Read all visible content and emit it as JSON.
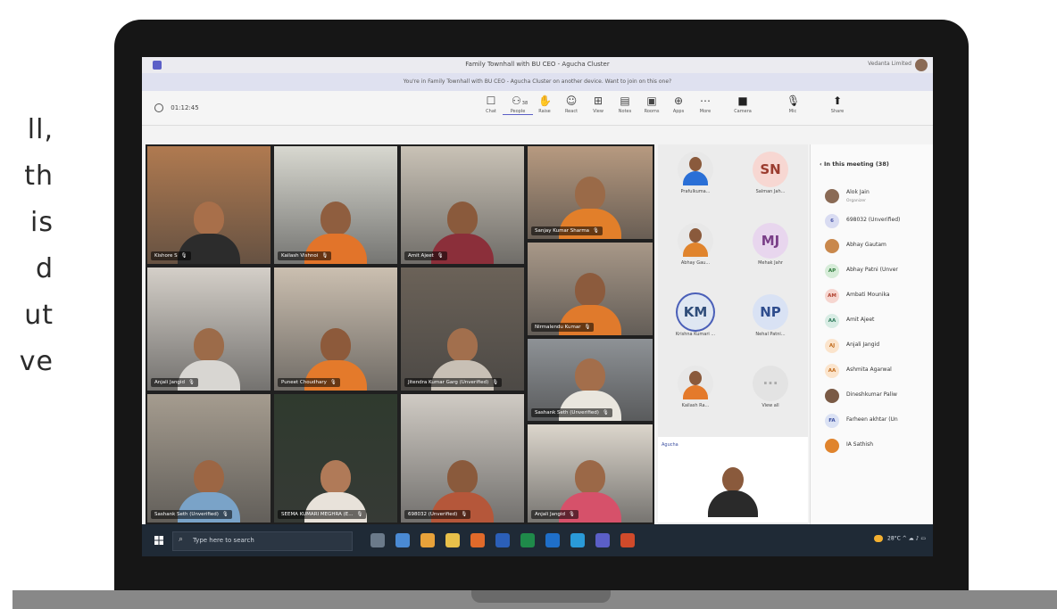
{
  "side_text": {
    "lines": [
      "ll,",
      "th",
      "is",
      "d",
      "ut",
      "ve"
    ]
  },
  "window": {
    "title": "Family Townhall with BU CEO - Agucha Cluster",
    "org": "Vedanta Limited",
    "banner": "You're in Family Townhall with BU CEO - Agucha Cluster on another device. Want to join on this one?"
  },
  "toolbar": {
    "timer": "01:12:45",
    "buttons": [
      {
        "id": "chat",
        "label": "Chat",
        "icon": "chat-icon",
        "glyph": "☐"
      },
      {
        "id": "people",
        "label": "People",
        "icon": "people-icon",
        "glyph": "⚇",
        "badge": "38"
      },
      {
        "id": "raise",
        "label": "Raise",
        "icon": "raise-hand-icon",
        "glyph": "✋"
      },
      {
        "id": "react",
        "label": "React",
        "icon": "react-icon",
        "glyph": "☺"
      },
      {
        "id": "view",
        "label": "View",
        "icon": "view-icon",
        "glyph": "⊞"
      },
      {
        "id": "notes",
        "label": "Notes",
        "icon": "notes-icon",
        "glyph": "▤"
      },
      {
        "id": "rooms",
        "label": "Rooms",
        "icon": "rooms-icon",
        "glyph": "▣"
      },
      {
        "id": "apps",
        "label": "Apps",
        "icon": "apps-icon",
        "glyph": "⊕"
      },
      {
        "id": "more",
        "label": "More",
        "icon": "more-icon",
        "glyph": "⋯"
      },
      {
        "id": "camera",
        "label": "Camera",
        "icon": "camera-icon",
        "glyph": "■"
      },
      {
        "id": "mic",
        "label": "Mic",
        "icon": "mic-icon",
        "glyph": "🎙"
      },
      {
        "id": "share",
        "label": "Share",
        "icon": "share-icon",
        "glyph": "⬆"
      }
    ]
  },
  "video_tiles": [
    {
      "name": "Kishore S",
      "bg": "#b07a50",
      "skin": "#a86f4a",
      "shirt": "#2c2c2c"
    },
    {
      "name": "Kailash Vishnoi",
      "bg": "#d8d8d0",
      "skin": "#8f5e3f",
      "shirt": "#e2742a"
    },
    {
      "name": "Amit Ajeet",
      "bg": "#c9c2b6",
      "skin": "#8a5a3c",
      "shirt": "#8b2f3a"
    },
    {
      "name": "Sanjay Kumar Sharma",
      "bg": "#b79a80",
      "skin": "#9a6a48",
      "shirt": "#e27f2a"
    },
    {
      "name": "Anjali Jangid",
      "bg": "#d4cfc8",
      "skin": "#9c6b49",
      "shirt": "#d8d6d2"
    },
    {
      "name": "Puneet Choudhary",
      "bg": "#cbbfb0",
      "skin": "#8d5a3b",
      "shirt": "#e47a2b"
    },
    {
      "name": "Jitendra Kumar Garg (Unverified)",
      "bg": "#6b6258",
      "skin": "#a26f4d",
      "shirt": "#c8c0b5"
    },
    {
      "name": "Nirmalendu Kumar",
      "bg": "#a89888",
      "skin": "#8c5b3d",
      "shirt": "#e07a2c"
    },
    {
      "name": "Sashank Seth (Unverified)",
      "bg": "#8e9296",
      "skin": "#a36e4b",
      "shirt": "#e9e6de"
    },
    {
      "name": "Sashank Seth (Unverified)",
      "bg": "#a59c8f",
      "skin": "#9c6644",
      "shirt": "#7aa3c8"
    },
    {
      "name": "SEEMA KUMARI MEGHRA (E...",
      "bg": "#2f3a2e",
      "skin": "#b07a58",
      "shirt": "#e8e2da"
    },
    {
      "name": "698032 (Unverified)",
      "bg": "#d0cbc4",
      "skin": "#8a5a3c",
      "shirt": "#b5573a"
    },
    {
      "name": "Anjali Jangid",
      "bg": "#dcd6cc",
      "skin": "#9b6847",
      "shirt": "#d6516a"
    }
  ],
  "grid_people": [
    {
      "name": "Prafulkuma...",
      "initials": "",
      "bg": "#e8e8e8",
      "fg": "#333",
      "photo": true,
      "shirt": "#2a6fd6"
    },
    {
      "name": "Salman Jah...",
      "initials": "SN",
      "bg": "#f7d7d2",
      "fg": "#9b3c2f",
      "photo": false
    },
    {
      "name": "Abhay Gau...",
      "initials": "",
      "bg": "#e8e8e8",
      "fg": "#333",
      "photo": true,
      "shirt": "#e0842d"
    },
    {
      "name": "Mehak Jahr",
      "initials": "MJ",
      "bg": "#e8d6ee",
      "fg": "#7a3f88",
      "photo": false
    },
    {
      "name": "Krishna Kumari ...",
      "initials": "KM",
      "bg": "#dfe7f2",
      "fg": "#2f4d7a",
      "photo": false
    },
    {
      "name": "Nehal Patni...",
      "initials": "NP",
      "bg": "#d9e2f4",
      "fg": "#2f4d8e",
      "photo": false
    },
    {
      "name": "Kailash Ra...",
      "initials": "",
      "bg": "#e8e8e8",
      "fg": "#333",
      "photo": true,
      "shirt": "#e47a2b"
    },
    {
      "name": "View all",
      "initials": "···",
      "bg": "#e3e3e3",
      "fg": "#aaa",
      "photo": false
    }
  ],
  "shared_content": {
    "header": "Agucha"
  },
  "participants_panel": {
    "title": "In this meeting (38)",
    "people": [
      {
        "name": "Alok Jain",
        "sub": "Organizer",
        "initials": "",
        "bg": "#8a6a55",
        "fg": "#fff"
      },
      {
        "name": "698032 (Unverified)",
        "sub": "",
        "initials": "6",
        "bg": "#d9dcf2",
        "fg": "#4a55a8"
      },
      {
        "name": "Abhay Gautam",
        "sub": "",
        "initials": "",
        "bg": "#c9884c",
        "fg": "#fff"
      },
      {
        "name": "Abhay Patni (Unver",
        "sub": "",
        "initials": "AP",
        "bg": "#d6ecd8",
        "fg": "#2d7a3a"
      },
      {
        "name": "Ambati Mounika",
        "sub": "",
        "initials": "AM",
        "bg": "#f6d6d0",
        "fg": "#b0412f"
      },
      {
        "name": "Amit Ajeet",
        "sub": "",
        "initials": "AA",
        "bg": "#d8ece4",
        "fg": "#2d7a5a"
      },
      {
        "name": "Anjali Jangid",
        "sub": "",
        "initials": "AJ",
        "bg": "#fbe4cc",
        "fg": "#c06a1a"
      },
      {
        "name": "Ashmita Agarwal",
        "sub": "",
        "initials": "AA",
        "bg": "#fbe4cc",
        "fg": "#c06a1a"
      },
      {
        "name": "Dineshkumar Paliw",
        "sub": "",
        "initials": "",
        "bg": "#7a5a45",
        "fg": "#fff"
      },
      {
        "name": "Farheen akhtar (Un",
        "sub": "",
        "initials": "FA",
        "bg": "#dbe2f4",
        "fg": "#3a4ea0"
      },
      {
        "name": "IA Sathish",
        "sub": "",
        "initials": "",
        "bg": "#e0842d",
        "fg": "#fff"
      }
    ]
  },
  "taskbar": {
    "search_placeholder": "Type here to search",
    "weather": "28°C",
    "apps": [
      {
        "icon": "task-view-icon",
        "color": "#6b7a8a"
      },
      {
        "icon": "pen-icon",
        "color": "#4a8ad4"
      },
      {
        "icon": "chrome-icon",
        "color": "#e8a23a"
      },
      {
        "icon": "file-explorer-icon",
        "color": "#e8c04a"
      },
      {
        "icon": "firefox-icon",
        "color": "#e06a2a"
      },
      {
        "icon": "word-icon",
        "color": "#2b5fb8"
      },
      {
        "icon": "excel-icon",
        "color": "#1f8a4a"
      },
      {
        "icon": "outlook-icon",
        "color": "#1f6fc9"
      },
      {
        "icon": "edge-icon",
        "color": "#2a9ad8"
      },
      {
        "icon": "teams-icon",
        "color": "#5b5fc7"
      },
      {
        "icon": "powerpoint-icon",
        "color": "#d04a2a"
      }
    ]
  }
}
